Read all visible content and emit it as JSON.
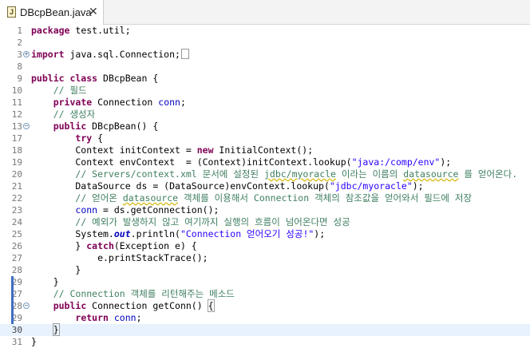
{
  "tab": {
    "title": "DBcpBean.java",
    "icon_name": "java-file-icon",
    "close": "✕"
  },
  "colors": {
    "keyword": "#7f0055",
    "comment": "#3f7f5f",
    "string": "#2a00ff",
    "field": "#0000c0"
  },
  "lines": [
    {
      "n": "1",
      "code": [
        {
          "t": "package",
          "c": "kw"
        },
        {
          "t": " test.util;"
        }
      ]
    },
    {
      "n": "2",
      "code": []
    },
    {
      "n": "3",
      "fold": "+",
      "code": [
        {
          "t": "import",
          "c": "kw"
        },
        {
          "t": " java.sql.Connection;"
        },
        {
          "t": "",
          "c": "folded"
        }
      ]
    },
    {
      "n": "8",
      "code": []
    },
    {
      "n": "9",
      "code": [
        {
          "t": "public class",
          "c": "kw"
        },
        {
          "t": " DBcpBean {"
        }
      ]
    },
    {
      "n": "10",
      "code": [
        {
          "t": "    "
        },
        {
          "t": "// 필드",
          "c": "cm"
        }
      ]
    },
    {
      "n": "11",
      "code": [
        {
          "t": "    "
        },
        {
          "t": "private",
          "c": "kw"
        },
        {
          "t": " Connection "
        },
        {
          "t": "conn",
          "c": "fd"
        },
        {
          "t": ";"
        }
      ]
    },
    {
      "n": "12",
      "code": [
        {
          "t": "    "
        },
        {
          "t": "// 생성자",
          "c": "cm"
        }
      ]
    },
    {
      "n": "13",
      "fold": "-",
      "code": [
        {
          "t": "    "
        },
        {
          "t": "public",
          "c": "kw"
        },
        {
          "t": " DBcpBean() {"
        }
      ]
    },
    {
      "n": "17",
      "code": [
        {
          "t": "        "
        },
        {
          "t": "try",
          "c": "kw"
        },
        {
          "t": " {"
        }
      ]
    },
    {
      "n": "18",
      "code": [
        {
          "t": "        Context initContext = "
        },
        {
          "t": "new",
          "c": "kw"
        },
        {
          "t": " InitialContext();"
        }
      ]
    },
    {
      "n": "19",
      "code": [
        {
          "t": "        Context envContext  = (Context)initContext.lookup("
        },
        {
          "t": "\"java:/comp/env\"",
          "c": "st"
        },
        {
          "t": ");"
        }
      ]
    },
    {
      "n": "20",
      "code": [
        {
          "t": "        "
        },
        {
          "t": "// Servers/context.xml 문서에 설정된 ",
          "c": "cm"
        },
        {
          "t": "jdbc/myoracle",
          "c": "cm sq"
        },
        {
          "t": " 이라는 이름의 ",
          "c": "cm"
        },
        {
          "t": "datasource",
          "c": "cm sq"
        },
        {
          "t": " 를 얻어온다.",
          "c": "cm"
        }
      ]
    },
    {
      "n": "21",
      "code": [
        {
          "t": "        DataSource ds = (DataSource)envContext.lookup("
        },
        {
          "t": "\"jdbc/myoracle\"",
          "c": "st"
        },
        {
          "t": ");"
        }
      ]
    },
    {
      "n": "22",
      "code": [
        {
          "t": "        "
        },
        {
          "t": "// 얻어온 ",
          "c": "cm"
        },
        {
          "t": "datasource",
          "c": "cm sq"
        },
        {
          "t": " 객체를 이용해서 Connection 객체의 참조값을 얻어와서 필드에 저장",
          "c": "cm"
        }
      ]
    },
    {
      "n": "23",
      "code": [
        {
          "t": "        "
        },
        {
          "t": "conn",
          "c": "fd"
        },
        {
          "t": " = ds.getConnection();"
        }
      ]
    },
    {
      "n": "24",
      "code": [
        {
          "t": "        "
        },
        {
          "t": "// 예외가 발생하지 않고 여기까지 실행의 흐름이 넘어온다면 성공",
          "c": "cm"
        }
      ]
    },
    {
      "n": "25",
      "code": [
        {
          "t": "        System."
        },
        {
          "t": "out",
          "c": "sf"
        },
        {
          "t": ".println("
        },
        {
          "t": "\"Connection 얻어오기 성공!\"",
          "c": "st"
        },
        {
          "t": ");"
        }
      ]
    },
    {
      "n": "26",
      "code": [
        {
          "t": "        } "
        },
        {
          "t": "catch",
          "c": "kw"
        },
        {
          "t": "(Exception e) {"
        }
      ]
    },
    {
      "n": "27",
      "code": [
        {
          "t": "            e.printStackTrace();"
        }
      ]
    },
    {
      "n": "28",
      "code": [
        {
          "t": "        }"
        }
      ]
    },
    {
      "n": "29",
      "code": [
        {
          "t": "    }"
        }
      ]
    },
    {
      "n": "27",
      "code": [
        {
          "t": "    "
        },
        {
          "t": "// Connection 객체를 리턴해주는 메소드",
          "c": "cm"
        }
      ]
    },
    {
      "n": "28",
      "fold": "-",
      "code": [
        {
          "t": "    "
        },
        {
          "t": "public",
          "c": "kw"
        },
        {
          "t": " Connection getConn() "
        },
        {
          "t": "{",
          "c": "bx"
        }
      ]
    },
    {
      "n": "29",
      "code": [
        {
          "t": "        "
        },
        {
          "t": "return",
          "c": "kw"
        },
        {
          "t": " "
        },
        {
          "t": "conn",
          "c": "fd"
        },
        {
          "t": ";"
        }
      ]
    },
    {
      "n": "30",
      "current": true,
      "code": [
        {
          "t": "    "
        },
        {
          "t": "}",
          "c": "bx"
        },
        {
          "t": "",
          "c": "caret"
        }
      ]
    },
    {
      "n": "31",
      "code": [
        {
          "t": "}"
        }
      ]
    }
  ]
}
